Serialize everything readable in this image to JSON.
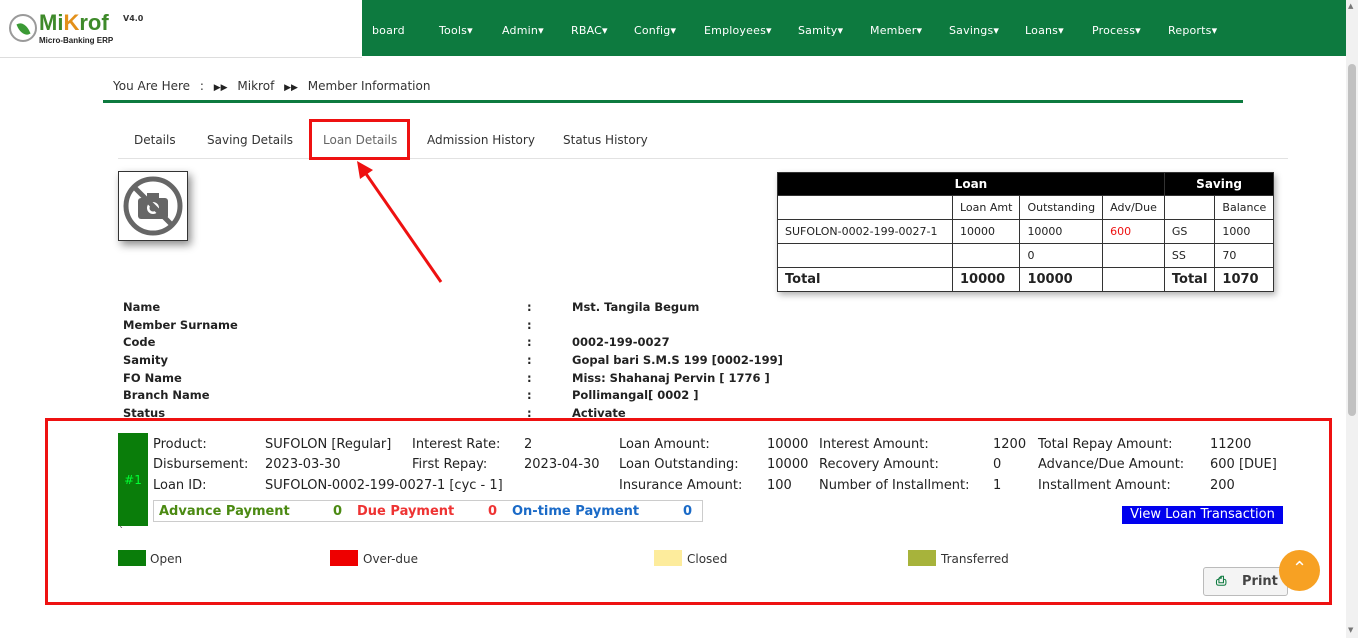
{
  "app": {
    "logo_name_prefix": "Mi",
    "logo_name_k": "K",
    "logo_name_suffix": "rof",
    "version": "V4.0",
    "subtitle": "Micro-Banking ERP"
  },
  "nav": {
    "items": [
      "board",
      "Tools",
      "Admin",
      "RBAC",
      "Config",
      "Employees",
      "Samity",
      "Member",
      "Savings",
      "Loans",
      "Process",
      "Reports"
    ]
  },
  "breadcrumb": {
    "prefix": "You Are Here",
    "sep": ":",
    "items": [
      "Mikrof",
      "Member Information"
    ]
  },
  "tabs": [
    "Details",
    "Saving Details",
    "Loan Details",
    "Admission History",
    "Status History"
  ],
  "summary_table": {
    "loan_header": "Loan",
    "saving_header": "Saving",
    "col_loan_amt": "Loan Amt",
    "col_outstanding": "Outstanding",
    "col_adv_due": "Adv/Due",
    "col_balance": "Balance",
    "rows": [
      {
        "loan_id": "SUFOLON-0002-199-0027-1",
        "loan_amt": "10000",
        "outstanding": "10000",
        "adv_due": "600",
        "saving_type": "GS",
        "balance": "1000"
      },
      {
        "loan_id": "",
        "loan_amt": "",
        "outstanding": "0",
        "adv_due": "",
        "saving_type": "SS",
        "balance": "70"
      }
    ],
    "total_label": "Total",
    "total_loan_amt": "10000",
    "total_outstanding": "10000",
    "total_saving_label": "Total",
    "total_balance": "1070"
  },
  "member": {
    "colon": ":",
    "fields": [
      {
        "label": "Name",
        "value": "Mst. Tangila Begum"
      },
      {
        "label": "Member Surname",
        "value": ""
      },
      {
        "label": "Code",
        "value": "0002-199-0027"
      },
      {
        "label": "Samity",
        "value": "Gopal bari S.M.S 199 [0002-199]"
      },
      {
        "label": "FO Name",
        "value": "Miss: Shahanaj Pervin [ 1776 ]"
      },
      {
        "label": "Branch Name",
        "value": "Pollimangal[ 0002 ]"
      },
      {
        "label": "Status",
        "value": "Activate"
      }
    ]
  },
  "loan": {
    "number": "#1",
    "product_label": "Product:",
    "product": "SUFOLON [Regular]",
    "interest_rate_label": "Interest Rate:",
    "interest_rate": "2",
    "loan_amount_label": "Loan Amount:",
    "loan_amount": "10000",
    "interest_amount_label": "Interest Amount:",
    "interest_amount": "1200",
    "total_repay_label": "Total Repay Amount:",
    "total_repay": "11200",
    "disbursement_label": "Disbursement:",
    "disbursement": "2023-03-30",
    "first_repay_label": "First Repay:",
    "first_repay": "2023-04-30",
    "outstanding_label": "Loan Outstanding:",
    "outstanding": "10000",
    "recovery_label": "Recovery Amount:",
    "recovery": "0",
    "adv_due_label": "Advance/Due Amount:",
    "adv_due": "600 [DUE]",
    "loan_id_label": "Loan ID:",
    "loan_id": "SUFOLON-0002-199-0027-1 [cyc - 1]",
    "insurance_label": "Insurance Amount:",
    "insurance": "100",
    "installments_label": "Number of Installment:",
    "installments": "1",
    "installment_amount_label": "Installment Amount:",
    "installment_amount": "200",
    "advance_payment_label": "Advance Payment",
    "advance_payment": "0",
    "due_payment_label": "Due Payment",
    "due_payment": "0",
    "ontime_payment_label": "On-time Payment",
    "ontime_payment": "0",
    "view_button": "View Loan Transaction",
    "tick": "`"
  },
  "legend": [
    {
      "label": "Open",
      "color": "#0a7d0a"
    },
    {
      "label": "Over-due",
      "color": "#ee0000"
    },
    {
      "label": "Closed",
      "color": "#fdec9c"
    },
    {
      "label": "Transferred",
      "color": "#a7b33b"
    }
  ],
  "print_button": "Print",
  "colors": {
    "brand": "#0d7a3f",
    "highlight": "#e11111",
    "link": "#0000ee"
  }
}
